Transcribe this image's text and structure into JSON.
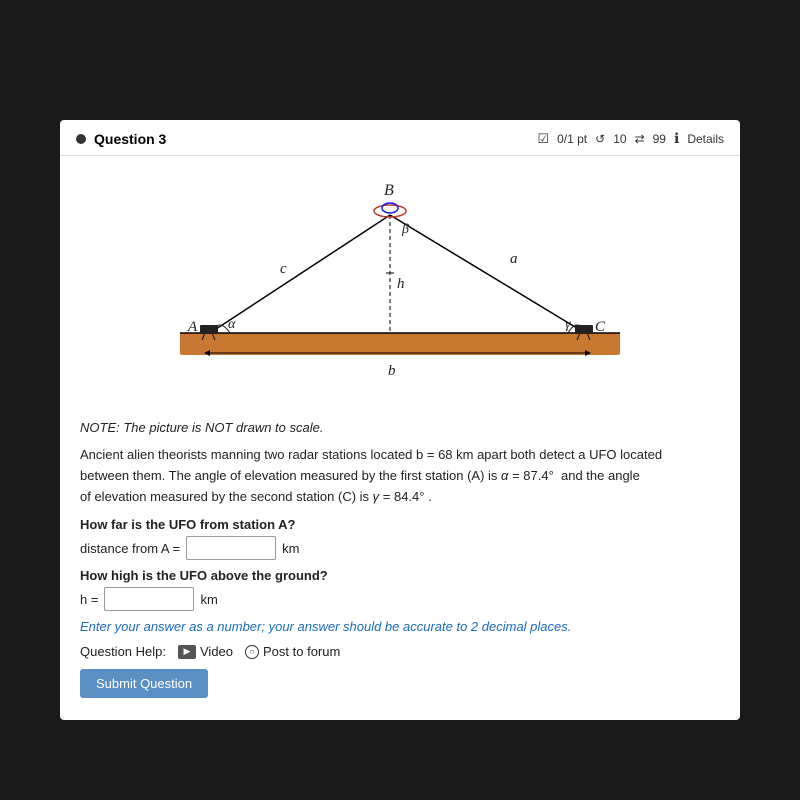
{
  "header": {
    "question_label": "Question 3",
    "dot_color": "#333",
    "score": "0/1 pt",
    "attempts": "10",
    "submissions": "99",
    "details_label": "Details"
  },
  "diagram": {
    "title": "Triangle with UFO diagram"
  },
  "note": {
    "text": "NOTE: The picture is NOT drawn to scale."
  },
  "problem": {
    "text1": "Ancient alien theorists manning two radar stations located b = 68 km apart both detect a UFO located",
    "text2": "between them. The angle of elevation measured by the first station (A) is α = 87.4°  and the angle",
    "text3": "of elevation measured by the second station (C) is γ = 84.4° ."
  },
  "questions": {
    "q1_label": "How far is the UFO from station A?",
    "q1_input_prefix": "distance from A =",
    "q1_unit": "km",
    "q1_value": "",
    "q2_label": "How high is the UFO above the ground?",
    "q2_input_prefix": "h =",
    "q2_unit": "km",
    "q2_value": ""
  },
  "accuracy_note": "Enter your answer as a number; your answer should be accurate to 2 decimal places.",
  "help": {
    "label": "Question Help:",
    "video_label": "Video",
    "forum_label": "Post to forum"
  },
  "submit": {
    "label": "Submit Question"
  }
}
